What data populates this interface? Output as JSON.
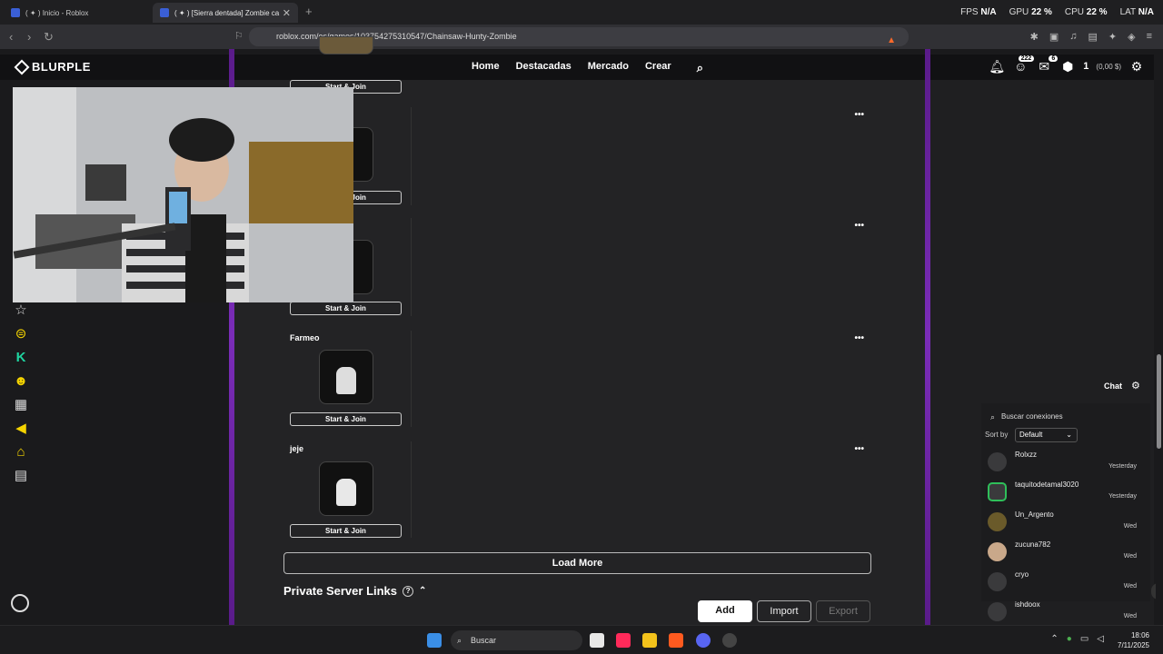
{
  "browser": {
    "tabs": [
      {
        "label": "( ✦ ) Inicio - Roblox"
      },
      {
        "label": "( ✦ ) [Sierra dentada] Zombie ca"
      }
    ],
    "perf": {
      "fps_label": "FPS",
      "fps": "N/A",
      "gpu_label": "GPU",
      "gpu": "22 %",
      "cpu_label": "CPU",
      "cpu": "22 %",
      "lat_label": "LAT",
      "lat": "N/A"
    },
    "url": "roblox.com/es/games/103754275310547/Chainsaw-Hunty-Zombie"
  },
  "site_nav": {
    "logo": "BLURPLE",
    "links": [
      "Home",
      "Destacadas",
      "Mercado",
      "Crear"
    ],
    "friends_badge": "222",
    "messages_badge": "6",
    "robux": "1",
    "robux_value": "(0,00 $)"
  },
  "servers": [
    {
      "name": "",
      "button": "Start & Join"
    },
    {
      "name": "",
      "button": "Start & Join"
    },
    {
      "name": "",
      "button": "Start & Join"
    },
    {
      "name": "Farmeo",
      "button": "Start & Join"
    },
    {
      "name": "jeje",
      "button": "Start & Join"
    }
  ],
  "load_more": "Load More",
  "private_links": {
    "title": "Private Server Links",
    "add": "Add",
    "import": "Import",
    "export": "Export"
  },
  "chat": {
    "label": "Chat",
    "search_placeholder": "Buscar conexiones",
    "sort_label": "Sort by",
    "sort_value": "Default",
    "connections": [
      {
        "name": "Rolxzz",
        "time": "Yesterday"
      },
      {
        "name": "taquitodetamal3020",
        "time": "Yesterday"
      },
      {
        "name": "Un_Argento",
        "time": "Wed"
      },
      {
        "name": "zucuna782",
        "time": "Wed"
      },
      {
        "name": "cryo",
        "time": "Wed"
      },
      {
        "name": "ishdoox",
        "time": "Wed"
      }
    ]
  },
  "taskbar": {
    "search": "Buscar",
    "time": "18:06",
    "date": "7/11/2025"
  }
}
